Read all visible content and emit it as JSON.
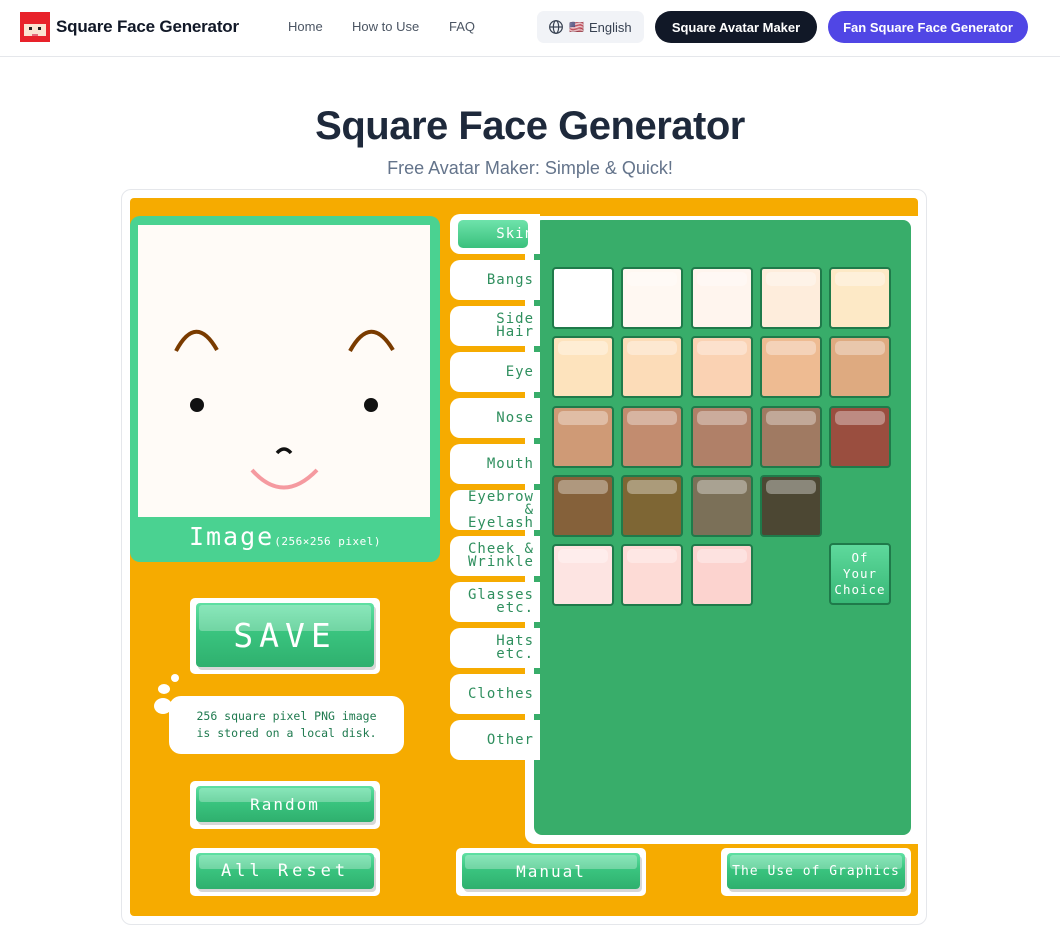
{
  "header": {
    "brand": "Square Face Generator",
    "nav": [
      "Home",
      "How to Use",
      "FAQ"
    ],
    "language": {
      "flag": "🇺🇸",
      "label": "English"
    },
    "cta_dark": "Square Avatar Maker",
    "cta_purple": "Fan Square Face Generator"
  },
  "hero": {
    "title": "Square Face Generator",
    "subtitle": "Free Avatar Maker: Simple & Quick!"
  },
  "app": {
    "image_label": "Image",
    "image_size": "(256×256 pixel)",
    "save_label": "SAVE",
    "save_tip_line1": "256 square pixel PNG image",
    "save_tip_line2": "is stored on a local disk.",
    "random_label": "Random",
    "reset_label": "All Reset",
    "manual_label": "Manual",
    "graphics_label": "The Use of Graphics",
    "tabs": [
      "Skin",
      "Bangs",
      "Side Hair",
      "Eye",
      "Nose",
      "Mouth",
      "Eyebrow & Eyelash",
      "Cheek & Wrinkle",
      "Glasses etc.",
      "Hats etc.",
      "Clothes",
      "Other"
    ],
    "active_tab": "Skin",
    "choice_label": [
      "Of",
      "Your",
      "Choice"
    ],
    "skin_colors": [
      [
        "#ffffff",
        "#fff8f2",
        "#fff5ee",
        "#feeddc",
        "#fde9c6"
      ],
      [
        "#fde3bd",
        "#fcdcb8",
        "#fad2b3",
        "#eebb92",
        "#deaa80"
      ],
      [
        "#cf9a76",
        "#c28c6f",
        "#b08068",
        "#a07a62",
        "#9a4e3f"
      ],
      [
        "#85613a",
        "#7e6634",
        "#7b7058",
        "#4c4733",
        null
      ],
      [
        "#fde4e2",
        "#fddbd6",
        "#fcd3cf",
        null,
        null
      ]
    ]
  }
}
